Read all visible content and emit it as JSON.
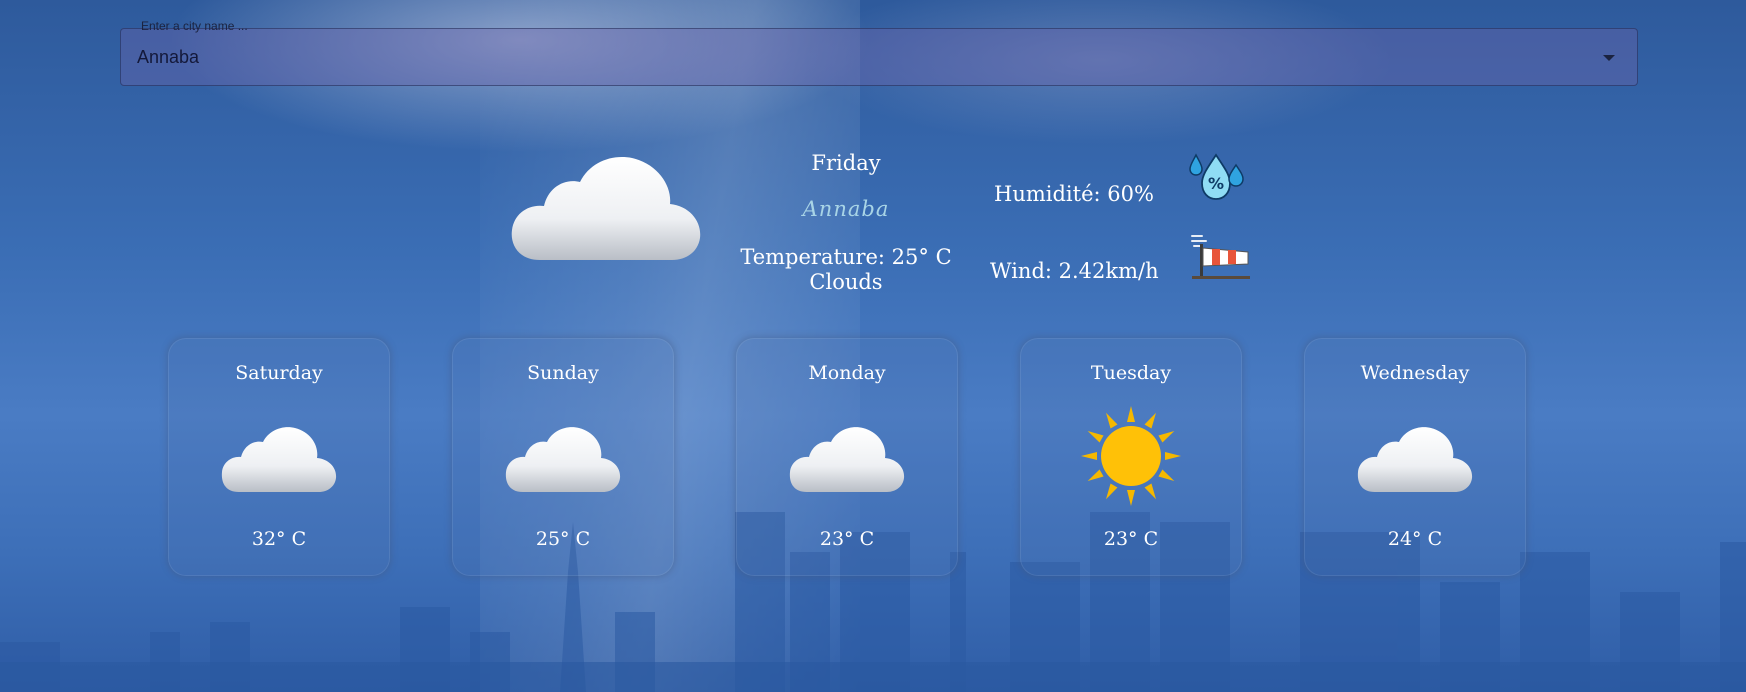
{
  "search": {
    "label": "Enter a city name ...",
    "value": "Annaba"
  },
  "current": {
    "day": "Friday",
    "city": "Annaba",
    "temperature": "Temperature: 25° C",
    "condition": "Clouds",
    "condition_icon": "cloud-icon",
    "humidity": "Humidité: 60%",
    "humidity_icon": "humidity-drops-icon",
    "wind": "Wind: 2.42km/h",
    "wind_icon": "windsock-icon"
  },
  "forecast": [
    {
      "day": "Saturday",
      "temp": "32° C",
      "icon": "cloud-icon"
    },
    {
      "day": "Sunday",
      "temp": "25° C",
      "icon": "cloud-icon"
    },
    {
      "day": "Monday",
      "temp": "23° C",
      "icon": "cloud-icon"
    },
    {
      "day": "Tuesday",
      "temp": "23° C",
      "icon": "sun-icon"
    },
    {
      "day": "Wednesday",
      "temp": "24° C",
      "icon": "cloud-icon"
    }
  ],
  "colors": {
    "city_accent": "#a8d4e6",
    "sun": "#ffc107",
    "sun_rays": "#f5b800"
  }
}
